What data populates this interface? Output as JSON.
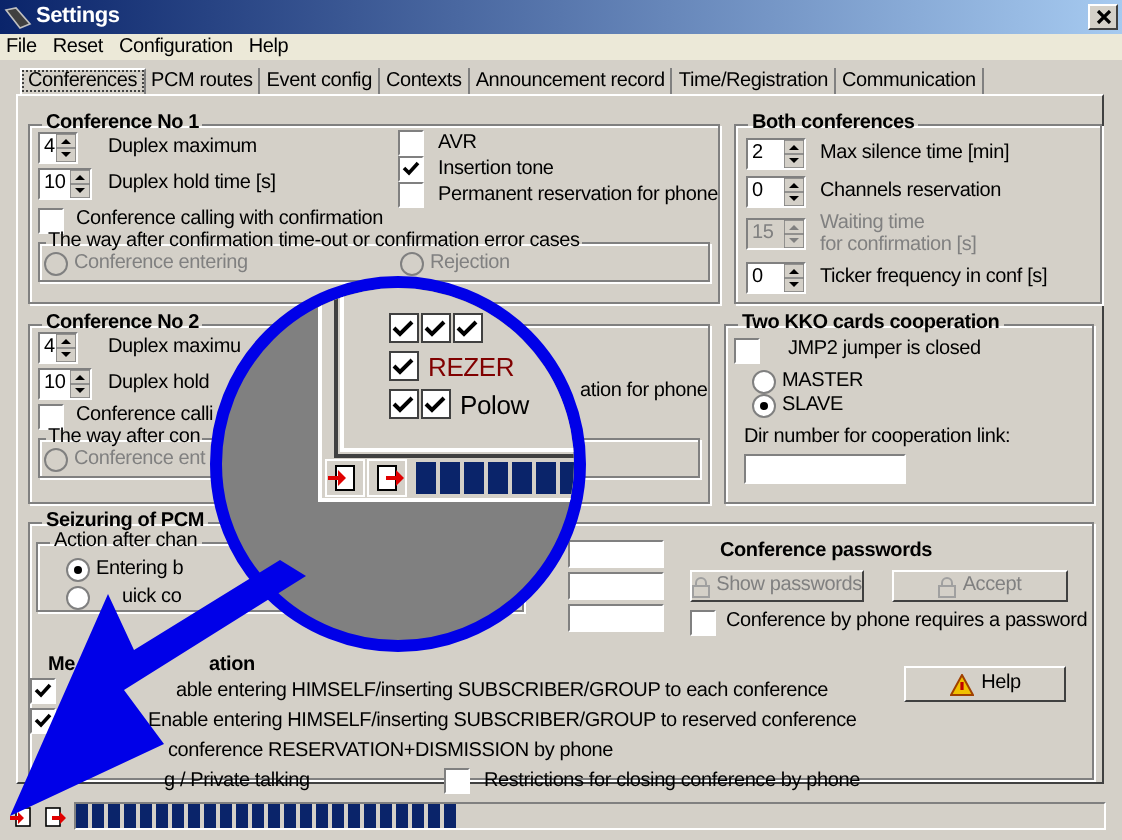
{
  "window": {
    "title": "Settings"
  },
  "menu": [
    "File",
    "Reset",
    "Configuration",
    "Help"
  ],
  "tabs": [
    {
      "label": "Conferences",
      "selected": true
    },
    {
      "label": "PCM routes",
      "selected": false
    },
    {
      "label": "Event config",
      "selected": false
    },
    {
      "label": "Contexts",
      "selected": false
    },
    {
      "label": "Announcement record",
      "selected": false
    },
    {
      "label": "Time/Registration",
      "selected": false
    },
    {
      "label": "Communication",
      "selected": false
    }
  ],
  "conference_1": {
    "title": "Conference No 1",
    "spins": [
      {
        "value": "4",
        "label": "Duplex maximum"
      },
      {
        "value": "10",
        "label": "Duplex hold time [s]"
      }
    ],
    "confirmation": {
      "label": "Conference calling with confirmation",
      "checked": false
    },
    "fallback": {
      "title": "The way after confirmation time-out or confirmation error cases",
      "options": [
        {
          "label": "Conference entering",
          "selected": false,
          "disabled": true
        },
        {
          "label": "Rejection",
          "selected": false,
          "disabled": true
        }
      ]
    },
    "options": [
      {
        "label": "AVR",
        "checked": false
      },
      {
        "label": "Insertion tone",
        "checked": true
      },
      {
        "label": "Permanent reservation for phone",
        "checked": false
      }
    ]
  },
  "conference_2": {
    "title": "Conference No 2",
    "spins": [
      {
        "value": "4",
        "label": "Duplex maximu"
      },
      {
        "value": "10",
        "label": "Duplex hold"
      }
    ],
    "confirmation": {
      "label": "Conference calli",
      "checked": false
    },
    "fallback": {
      "title": "The way after con",
      "options": [
        {
          "label": "Conference ent",
          "selected": false,
          "disabled": true
        }
      ]
    },
    "option_tail": "ation for phone"
  },
  "both_conferences": {
    "title": "Both conferences",
    "spins": [
      {
        "value": "2",
        "label": "Max silence time [min]",
        "disabled": false
      },
      {
        "value": "0",
        "label": "Channels reservation",
        "disabled": false
      },
      {
        "value": "15",
        "label": "Waiting time\nfor confirmation [s]",
        "disabled": true
      },
      {
        "value": "0",
        "label": "Ticker frequency in conf [s]",
        "disabled": false
      }
    ]
  },
  "kko": {
    "title": "Two KKO cards cooperation",
    "jumper": {
      "label": "JMP2 jumper is closed",
      "checked": false
    },
    "roles": [
      {
        "label": "MASTER",
        "selected": false
      },
      {
        "label": "SLAVE",
        "selected": true
      }
    ],
    "link_label": "Dir number for cooperation link:"
  },
  "seizuring": {
    "title": "Seizuring of PCM",
    "action_title": "Action after chan",
    "actions": [
      {
        "label": "Entering b",
        "selected": true
      },
      {
        "label": "uick co",
        "selected": false
      }
    ]
  },
  "passwords": {
    "title": "Conference passwords",
    "buttons": [
      {
        "label": "Show passwords",
        "disabled": true
      },
      {
        "label": "Accept",
        "disabled": true
      }
    ],
    "requires": {
      "label": "Conference by phone requires a password",
      "checked": false
    }
  },
  "membership": {
    "title_parts": [
      "Me",
      "ation"
    ],
    "rows": [
      {
        "label": "able entering HIMSELF/inserting SUBSCRIBER/GROUP to each conference",
        "checked": true
      },
      {
        "label": "Enable entering HIMSELF/inserting SUBSCRIBER/GROUP to reserved conference",
        "checked": true
      },
      {
        "label": "conference RESERVATION+DISMISSION by phone"
      },
      {
        "label": "g / Private talking"
      }
    ],
    "restriction": {
      "label": "Restrictions for closing conference by phone",
      "checked": false
    }
  },
  "help_button": "Help",
  "magnifier": {
    "rows": [
      {
        "checks": [
          {
            "checked": true
          },
          {
            "checked": true
          },
          {
            "checked": true
          }
        ]
      },
      {
        "checks": [
          {
            "checked": true
          }
        ],
        "label": "REZER",
        "color": "#800000"
      },
      {
        "checks": [
          {
            "checked": true
          },
          {
            "checked": true
          }
        ],
        "label": "Polow",
        "color": "#000000"
      }
    ]
  },
  "status_bar": {
    "progress": {
      "level": 0.37
    }
  }
}
